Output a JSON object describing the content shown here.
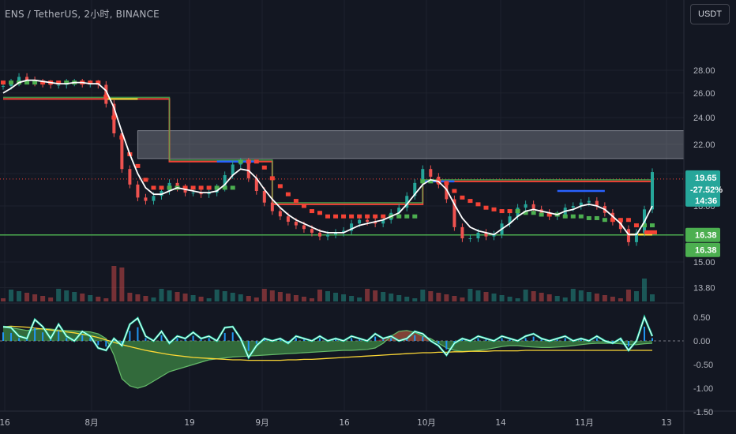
{
  "header": {
    "symbol": "ENS / TetherUS, 2小时, BINANCE",
    "currency_button": "USDT"
  },
  "colors": {
    "background": "#131722",
    "green": "#4caf50",
    "red": "#f44336",
    "yellow": "#ffeb3b",
    "blue": "#2962ff",
    "white": "#ffffff",
    "aqua": "#4dd0a0",
    "grid": "#1e222d"
  },
  "chart_data": [
    {
      "type": "line",
      "panel": "price",
      "y_ticks": [
        "28.00",
        "26.00",
        "24.00",
        "22.00",
        "20.00",
        "18.00",
        "16.38",
        "15.00",
        "13.80"
      ],
      "x_ticks": [
        "16",
        "8月",
        "19",
        "9月",
        "16",
        "10月",
        "14",
        "11月",
        "13"
      ],
      "price_axis_scale": "log",
      "grid": true,
      "price_close": [
        26.6,
        26.9,
        27.4,
        27.1,
        26.9,
        26.8,
        26.7,
        26.7,
        26.9,
        26.9,
        26.8,
        26.8,
        26.7,
        25.1,
        22.8,
        20.3,
        19.3,
        18.5,
        18.3,
        18.6,
        18.9,
        19.4,
        19.1,
        18.8,
        18.8,
        18.7,
        18.8,
        19.1,
        19.9,
        20.6,
        20.8,
        19.7,
        18.9,
        18.2,
        17.7,
        17.4,
        17.1,
        16.9,
        16.7,
        16.5,
        16.3,
        16.4,
        16.5,
        16.6,
        17.0,
        17.2,
        17.1,
        17.0,
        17.2,
        17.6,
        17.9,
        18.6,
        19.4,
        20.3,
        19.8,
        19.3,
        18.4,
        16.8,
        16.2,
        16.2,
        16.5,
        16.3,
        16.4,
        17.0,
        17.4,
        17.9,
        18.1,
        17.8,
        17.6,
        17.4,
        17.5,
        17.9,
        18.0,
        18.2,
        18.3,
        18.0,
        17.6,
        17.1,
        16.7,
        16.0,
        16.5,
        17.8,
        20.1
      ],
      "price_change": "-27.52%",
      "last_price": "19.65",
      "countdown": "14:36",
      "support_level": "16.38",
      "support_level_2": "16.38",
      "upper_zone": [
        21.0,
        23.0
      ],
      "series": [
        {
          "name": "",
          "values": [
            26.9,
            26.9,
            26.9,
            26.9,
            26.9,
            26.9,
            26.9,
            26.9,
            26.9,
            26.9,
            26.9,
            26.9,
            26.9,
            25.7,
            24.0,
            22.5,
            21.3,
            20.5,
            19.6,
            19.1,
            19.1,
            19.1,
            19.1,
            19.1,
            19.1,
            19.1,
            19.1,
            19.1,
            19.1,
            19.1,
            20.8,
            20.8,
            20.8,
            20.4,
            19.7,
            19.2,
            18.7,
            18.3,
            18.0,
            17.7,
            17.6,
            17.4,
            17.4,
            17.4,
            17.4,
            17.4,
            17.4,
            17.4,
            17.4,
            17.4,
            17.4,
            17.4,
            17.4,
            19.5,
            19.5,
            19.5,
            19.4,
            18.9,
            18.5,
            18.3,
            18.1,
            17.9,
            17.8,
            17.7,
            17.7,
            17.7,
            17.6,
            17.6,
            17.5,
            17.5,
            17.5,
            17.4,
            17.4,
            17.4,
            17.3,
            17.3,
            17.2,
            17.2,
            17.2,
            17.2,
            16.9,
            16.9,
            16.9
          ]
        },
        {
          "name": "",
          "values": [
            25.5,
            25.5,
            25.5,
            25.5,
            25.5,
            25.5,
            25.5,
            25.5,
            25.5,
            25.5,
            25.5,
            25.5,
            25.5,
            25.5,
            25.5,
            25.5,
            25.5,
            25.5,
            25.5,
            25.5,
            25.5,
            20.8,
            20.8,
            20.8,
            20.8,
            20.8,
            20.8,
            20.8,
            20.8,
            20.8,
            20.8,
            20.8,
            20.8,
            20.8,
            18.1,
            18.1,
            18.1,
            18.1,
            18.1,
            18.1,
            18.1,
            18.1,
            18.1,
            18.1,
            18.1,
            18.1,
            18.1,
            18.1,
            18.1,
            18.1,
            18.1,
            18.1,
            18.1,
            19.5,
            19.5,
            19.5,
            19.5,
            19.5,
            19.5,
            19.5,
            19.5,
            19.5,
            19.5,
            19.5,
            19.5,
            19.5,
            19.5,
            19.5,
            19.5,
            19.5,
            19.5,
            19.5,
            19.5,
            19.5,
            19.5,
            19.5,
            19.5,
            19.5,
            19.5,
            19.5,
            19.5,
            19.5,
            19.5
          ]
        },
        {
          "name": "",
          "values": [
            26.0,
            26.4,
            26.9,
            27.1,
            27.1,
            27.0,
            26.9,
            26.8,
            26.8,
            26.9,
            26.9,
            26.8,
            26.8,
            26.2,
            24.8,
            22.9,
            21.3,
            20.0,
            19.1,
            18.7,
            18.7,
            18.9,
            19.1,
            19.0,
            18.9,
            18.8,
            18.8,
            18.9,
            19.3,
            19.9,
            20.3,
            20.2,
            19.7,
            19.0,
            18.4,
            17.9,
            17.5,
            17.2,
            17.0,
            16.8,
            16.6,
            16.5,
            16.5,
            16.5,
            16.7,
            16.9,
            17.0,
            17.1,
            17.2,
            17.4,
            17.6,
            18.1,
            18.7,
            19.3,
            19.6,
            19.5,
            19.0,
            18.1,
            17.3,
            16.8,
            16.6,
            16.5,
            16.4,
            16.7,
            17.0,
            17.4,
            17.7,
            17.8,
            17.7,
            17.6,
            17.5,
            17.7,
            17.8,
            18.0,
            18.1,
            18.0,
            17.8,
            17.4,
            17.0,
            16.4,
            16.4,
            17.1,
            18.0
          ]
        }
      ]
    },
    {
      "type": "area",
      "panel": "oscillator",
      "y_ticks": [
        "0.50",
        "0.00",
        "-0.50",
        "-1.00",
        "-1.50"
      ],
      "osc_fast": [
        0.3,
        0.28,
        0.1,
        0.05,
        0.45,
        0.3,
        0.05,
        0.35,
        0.1,
        0.0,
        0.2,
        0.1,
        -0.15,
        -0.2,
        0.05,
        -0.1,
        0.35,
        0.48,
        0.1,
        0.0,
        0.2,
        -0.05,
        0.1,
        0.05,
        0.18,
        0.05,
        0.1,
        0.0,
        0.28,
        0.3,
        0.05,
        -0.35,
        -0.1,
        0.05,
        0.0,
        0.05,
        -0.05,
        0.1,
        0.05,
        0.0,
        0.1,
        0.0,
        0.05,
        0.0,
        0.1,
        0.05,
        0.0,
        0.15,
        0.05,
        0.1,
        0.0,
        0.05,
        0.2,
        0.15,
        0.0,
        -0.1,
        -0.3,
        -0.05,
        0.05,
        0.0,
        0.1,
        0.05,
        0.0,
        0.1,
        0.05,
        0.0,
        0.1,
        0.15,
        0.05,
        0.0,
        0.05,
        0.1,
        0.0,
        0.05,
        0.0,
        0.1,
        0.0,
        -0.05,
        0.05,
        -0.2,
        0.0,
        0.5,
        0.1
      ],
      "osc_slow": [
        0.28,
        0.28,
        0.25,
        0.22,
        0.24,
        0.26,
        0.25,
        0.23,
        0.22,
        0.21,
        0.2,
        0.19,
        0.15,
        0.05,
        -0.3,
        -0.8,
        -0.95,
        -1.0,
        -0.95,
        -0.85,
        -0.75,
        -0.65,
        -0.6,
        -0.55,
        -0.5,
        -0.45,
        -0.4,
        -0.38,
        -0.36,
        -0.34,
        -0.33,
        -0.32,
        -0.31,
        -0.3,
        -0.29,
        -0.28,
        -0.27,
        -0.26,
        -0.25,
        -0.24,
        -0.23,
        -0.22,
        -0.21,
        -0.2,
        -0.2,
        -0.19,
        -0.18,
        -0.15,
        -0.05,
        0.1,
        0.2,
        0.22,
        0.18,
        0.1,
        0.05,
        -0.05,
        -0.15,
        -0.2,
        -0.22,
        -0.22,
        -0.2,
        -0.18,
        -0.15,
        -0.12,
        -0.1,
        -0.1,
        -0.12,
        -0.13,
        -0.14,
        -0.14,
        -0.13,
        -0.12,
        -0.1,
        -0.08,
        -0.06,
        -0.05,
        -0.05,
        -0.05,
        -0.06,
        -0.08,
        -0.08,
        -0.06,
        -0.05
      ],
      "signal": [
        0.3,
        0.31,
        0.3,
        0.29,
        0.27,
        0.25,
        0.23,
        0.21,
        0.19,
        0.17,
        0.14,
        0.11,
        0.07,
        0.02,
        -0.03,
        -0.08,
        -0.12,
        -0.16,
        -0.2,
        -0.23,
        -0.26,
        -0.29,
        -0.31,
        -0.33,
        -0.35,
        -0.36,
        -0.37,
        -0.38,
        -0.39,
        -0.4,
        -0.4,
        -0.41,
        -0.41,
        -0.41,
        -0.41,
        -0.41,
        -0.4,
        -0.4,
        -0.39,
        -0.39,
        -0.38,
        -0.37,
        -0.36,
        -0.35,
        -0.34,
        -0.33,
        -0.32,
        -0.31,
        -0.3,
        -0.29,
        -0.28,
        -0.27,
        -0.26,
        -0.25,
        -0.25,
        -0.24,
        -0.24,
        -0.23,
        -0.23,
        -0.22,
        -0.22,
        -0.22,
        -0.21,
        -0.21,
        -0.21,
        -0.21,
        -0.2,
        -0.2,
        -0.2,
        -0.2,
        -0.2,
        -0.2,
        -0.2,
        -0.2,
        -0.2,
        -0.2,
        -0.2,
        -0.2,
        -0.2,
        -0.2,
        -0.2,
        -0.2,
        -0.2
      ]
    }
  ]
}
